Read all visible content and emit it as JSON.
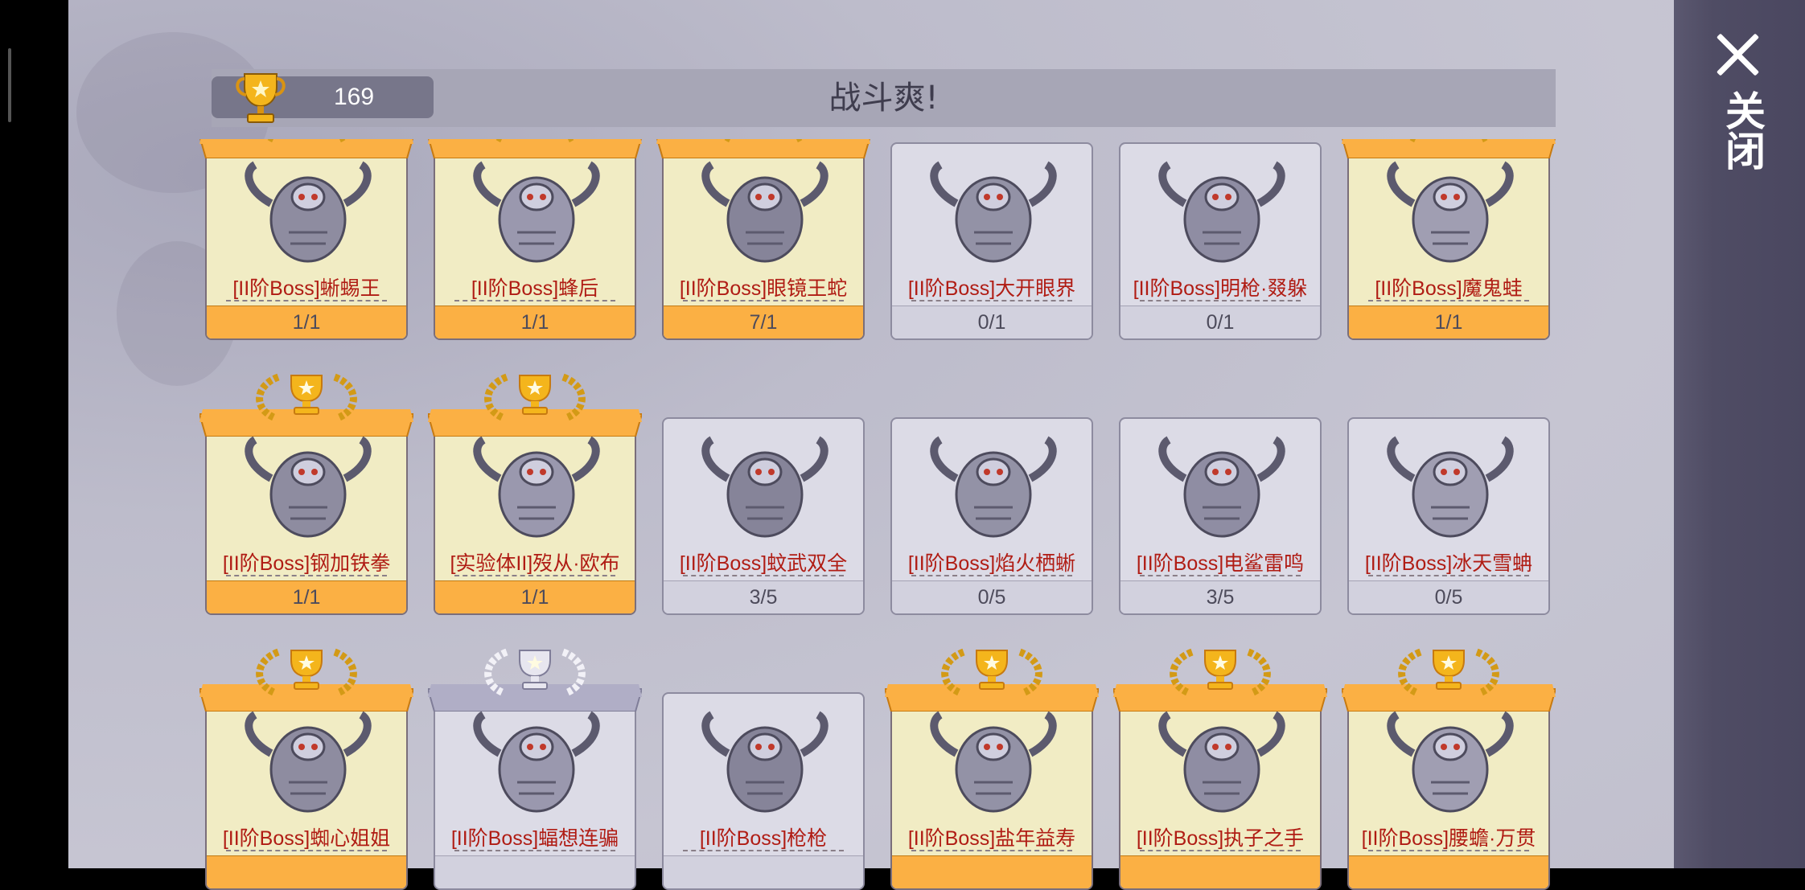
{
  "header": {
    "trophy_count": "169",
    "title": "战斗爽!"
  },
  "close": {
    "label": "关闭"
  },
  "colors": {
    "gold_ribbon": "#fbb044",
    "silver_ribbon": "#b0aec6",
    "name_red": "#b01c14",
    "card_won": "#f1ecc4",
    "card_lost": "#dcdbe6"
  },
  "bosses": [
    {
      "name": "[II阶Boss]蜥蜴王",
      "progress": "1/1",
      "award": "gold"
    },
    {
      "name": "[II阶Boss]蜂后",
      "progress": "1/1",
      "award": "gold"
    },
    {
      "name": "[II阶Boss]眼镜王蛇",
      "progress": "7/1",
      "award": "gold"
    },
    {
      "name": "[II阶Boss]大开眼界",
      "progress": "0/1",
      "award": "none"
    },
    {
      "name": "[II阶Boss]明枪·叕躲",
      "progress": "0/1",
      "award": "none"
    },
    {
      "name": "[II阶Boss]魔鬼蛙",
      "progress": "1/1",
      "award": "gold"
    },
    {
      "name": "[II阶Boss]钢加铁拳",
      "progress": "1/1",
      "award": "gold"
    },
    {
      "name": "[实验体II]歿从·欧布",
      "progress": "1/1",
      "award": "gold"
    },
    {
      "name": "[II阶Boss]蚊武双全",
      "progress": "3/5",
      "award": "none"
    },
    {
      "name": "[II阶Boss]焰火栖蜥",
      "progress": "0/5",
      "award": "none"
    },
    {
      "name": "[II阶Boss]电鲨雷鸣",
      "progress": "3/5",
      "award": "none"
    },
    {
      "name": "[II阶Boss]冰天雪蚺",
      "progress": "0/5",
      "award": "none"
    },
    {
      "name": "[II阶Boss]蜘心姐姐",
      "progress": "",
      "award": "gold"
    },
    {
      "name": "[II阶Boss]蝠想连骗",
      "progress": "",
      "award": "silver"
    },
    {
      "name": "[II阶Boss]枪枪",
      "progress": "",
      "award": "none"
    },
    {
      "name": "[II阶Boss]盐年益寿",
      "progress": "",
      "award": "gold"
    },
    {
      "name": "[II阶Boss]执子之手",
      "progress": "",
      "award": "gold"
    },
    {
      "name": "[II阶Boss]腰蟾·万贯",
      "progress": "",
      "award": "gold"
    }
  ]
}
